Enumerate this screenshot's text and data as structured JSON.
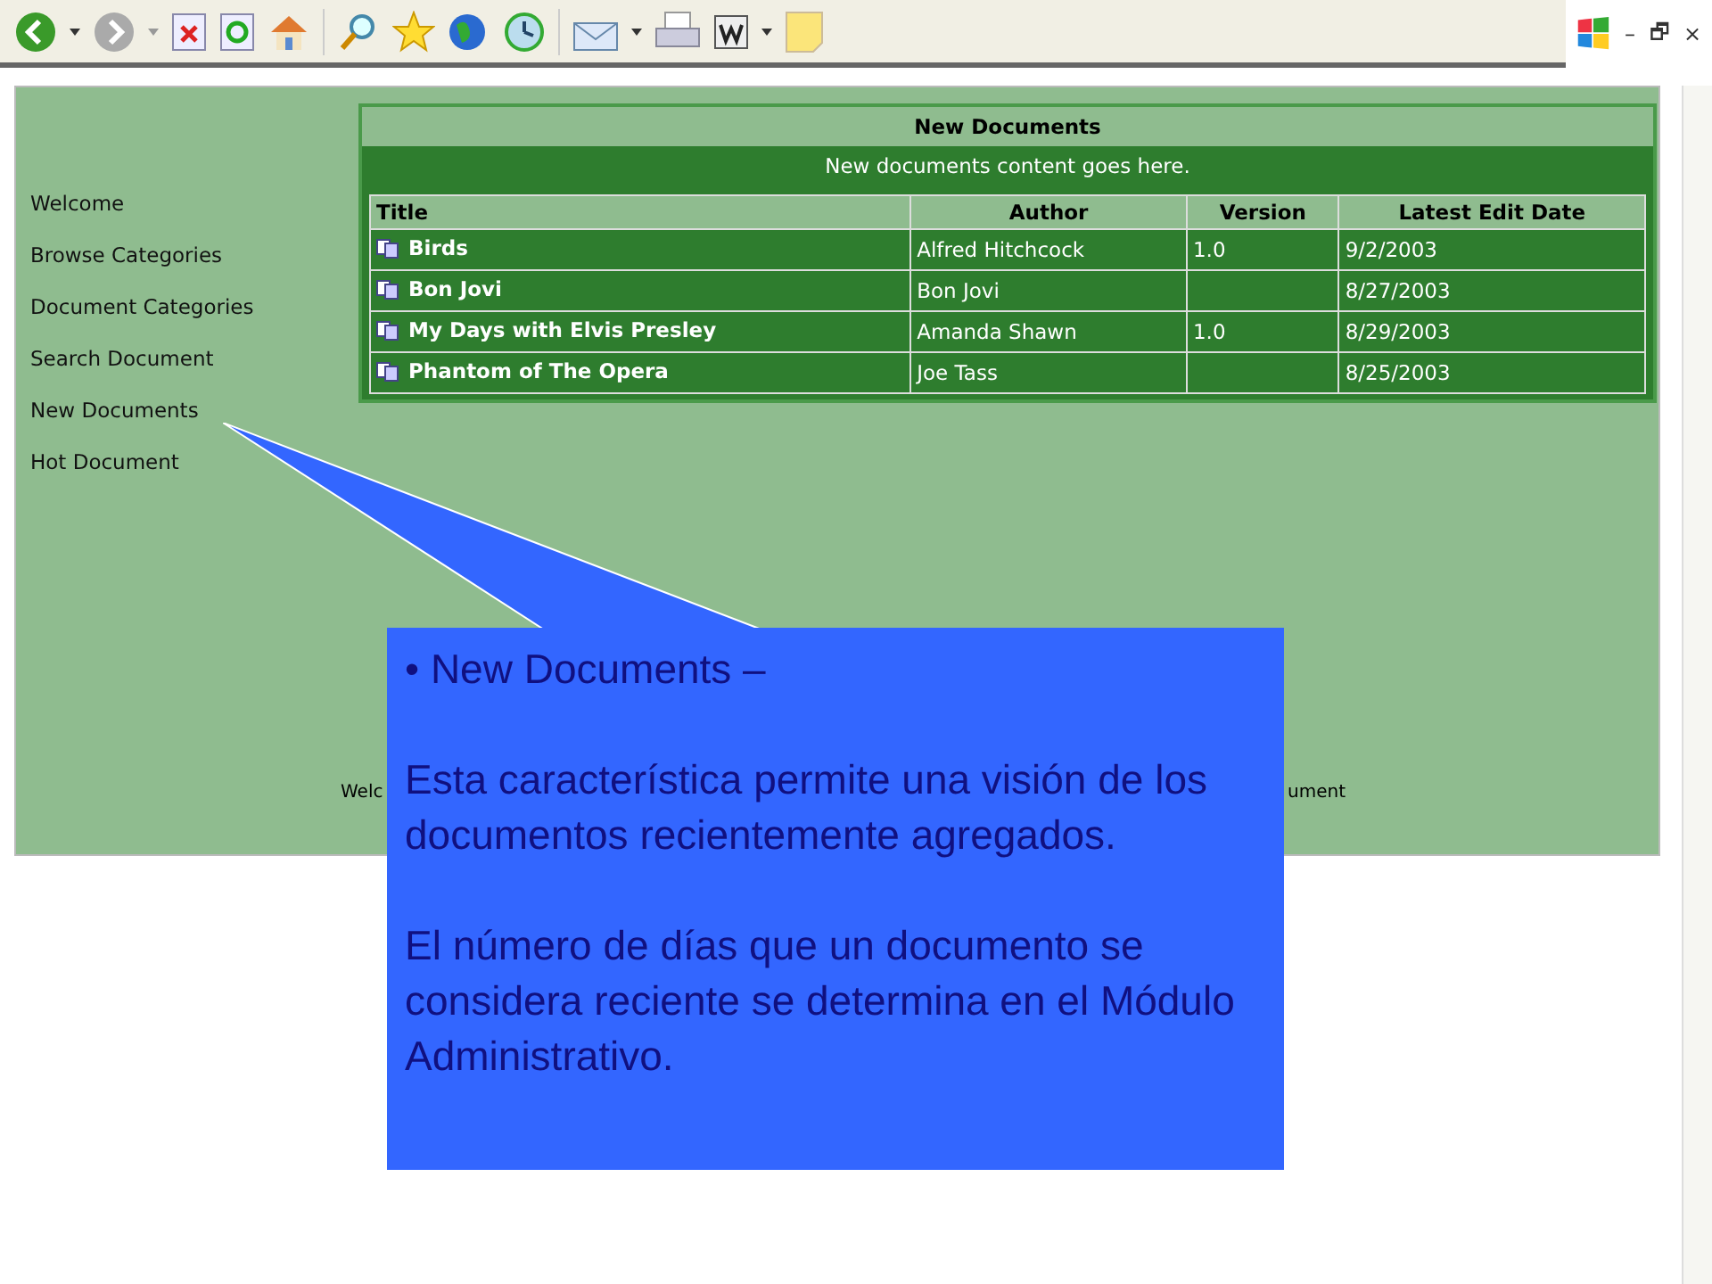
{
  "toolbar": {
    "window_controls": [
      "–",
      "🗗",
      "×"
    ]
  },
  "sidebar": {
    "items": [
      {
        "label": "Welcome"
      },
      {
        "label": "Browse Categories"
      },
      {
        "label": "Document Categories"
      },
      {
        "label": "Search Document"
      },
      {
        "label": "New Documents"
      },
      {
        "label": "Hot Document"
      }
    ]
  },
  "panel": {
    "title": "New Documents",
    "subtitle": "New documents content goes here.",
    "table": {
      "columns": [
        "Title",
        "Author",
        "Version",
        "Latest Edit Date"
      ],
      "rows": [
        {
          "title": "Birds",
          "author": "Alfred Hitchcock",
          "version": "1.0",
          "date": "9/2/2003"
        },
        {
          "title": "Bon Jovi",
          "author": "Bon Jovi",
          "version": "",
          "date": "8/27/2003"
        },
        {
          "title": "My Days with Elvis Presley",
          "author": "Amanda Shawn",
          "version": "1.0",
          "date": "8/29/2003"
        },
        {
          "title": "Phantom of The Opera",
          "author": "Joe Tass",
          "version": "",
          "date": "8/25/2003"
        }
      ]
    }
  },
  "footer": [
    "Welc",
    "ument"
  ],
  "callout": {
    "bullet": "•",
    "heading": "New Documents –",
    "paragraphs": [
      "Esta característica permite una visión de los documentos recientemente agregados.",
      "El número de días que un documento se considera reciente se determina en el Módulo Administrativo."
    ]
  }
}
